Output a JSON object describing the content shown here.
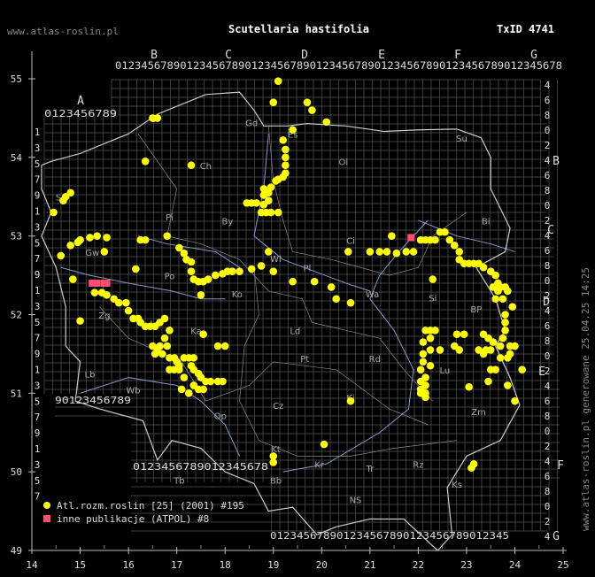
{
  "header": {
    "site": "www.atlas-roslin.pl",
    "title": "Scutellaria hastifolia",
    "taxon_id": "TxID 4741"
  },
  "side_note": "www.atlas-roslin.pl generowane 25.04.25 14:25",
  "axes": {
    "lon_ticks": [
      "14",
      "15",
      "16",
      "17",
      "18",
      "19",
      "20",
      "21",
      "22",
      "23",
      "24",
      "25"
    ],
    "lat_ticks": [
      "49",
      "50",
      "51",
      "52",
      "53",
      "54",
      "55"
    ]
  },
  "atpol": {
    "top_letters": [
      "B",
      "C",
      "D",
      "E",
      "F",
      "G"
    ],
    "top_digits": "012345678901234567890123456789012345678901234567890123456789012345678",
    "bottom_digits_a": "0123456789",
    "bottom_digits_b": "0123456789012345678901234567890123456789012345",
    "a_letter": "A",
    "a_digits": "0123456789",
    "west_digits": [
      "1",
      "3",
      "5",
      "7",
      "9",
      "1",
      "3",
      "5",
      "7",
      "9",
      "1",
      "3",
      "5",
      "7",
      "9",
      "1",
      "3",
      "5",
      "7",
      "9",
      "1",
      "3",
      "5",
      "7"
    ],
    "east_letters": [
      "B",
      "C",
      "D",
      "E",
      "F",
      "G"
    ],
    "east_digits": [
      "4",
      "6",
      "8",
      "0",
      "2",
      "4",
      "6",
      "8",
      "0",
      "2",
      "4",
      "6",
      "8",
      "0",
      "2",
      "4",
      "6",
      "8",
      "0",
      "2",
      "4",
      "6",
      "8",
      "0",
      "2",
      "4",
      "6",
      "8",
      "0",
      "2",
      "4"
    ],
    "bottom_left_digits": "90123456789",
    "bottom_left_digits2": "0123456789012345678"
  },
  "region_labels": [
    {
      "t": "Sl",
      "lon": 16.55,
      "lat": 54.45
    },
    {
      "t": "Gd",
      "lon": 18.55,
      "lat": 54.4
    },
    {
      "t": "Es",
      "lon": 19.4,
      "lat": 54.25
    },
    {
      "t": "Su",
      "lon": 22.9,
      "lat": 54.2
    },
    {
      "t": "Ol",
      "lon": 20.45,
      "lat": 53.9
    },
    {
      "t": "Ch",
      "lon": 17.6,
      "lat": 53.85
    },
    {
      "t": "Sz",
      "lon": 14.6,
      "lat": 53.45
    },
    {
      "t": "Pi",
      "lon": 16.85,
      "lat": 53.2
    },
    {
      "t": "By",
      "lon": 18.05,
      "lat": 53.15
    },
    {
      "t": "Bi",
      "lon": 23.4,
      "lat": 53.15
    },
    {
      "t": "Ci",
      "lon": 20.6,
      "lat": 52.9
    },
    {
      "t": "Gw",
      "lon": 15.25,
      "lat": 52.75
    },
    {
      "t": "Wl",
      "lon": 19.05,
      "lat": 52.67
    },
    {
      "t": "Pl",
      "lon": 19.7,
      "lat": 52.55
    },
    {
      "t": "Po",
      "lon": 16.85,
      "lat": 52.45
    },
    {
      "t": "Si",
      "lon": 22.3,
      "lat": 52.17
    },
    {
      "t": "BP",
      "lon": 23.2,
      "lat": 52.03
    },
    {
      "t": "Wa",
      "lon": 21.05,
      "lat": 52.22
    },
    {
      "t": "Ko",
      "lon": 18.25,
      "lat": 52.22
    },
    {
      "t": "Zg",
      "lon": 15.5,
      "lat": 51.95
    },
    {
      "t": "Le",
      "lon": 16.55,
      "lat": 51.85
    },
    {
      "t": "Ld",
      "lon": 19.45,
      "lat": 51.75
    },
    {
      "t": "Ka",
      "lon": 17.4,
      "lat": 51.75
    },
    {
      "t": "Pt",
      "lon": 19.65,
      "lat": 51.4
    },
    {
      "t": "Rd",
      "lon": 21.1,
      "lat": 51.4
    },
    {
      "t": "Lu",
      "lon": 22.55,
      "lat": 51.25
    },
    {
      "t": "Lb",
      "lon": 15.2,
      "lat": 51.2
    },
    {
      "t": "Wb",
      "lon": 16.1,
      "lat": 51.0
    },
    {
      "t": "Op",
      "lon": 17.9,
      "lat": 50.67
    },
    {
      "t": "Cz",
      "lon": 19.1,
      "lat": 50.8
    },
    {
      "t": "Ki",
      "lon": 20.6,
      "lat": 50.9
    },
    {
      "t": "Kt",
      "lon": 19.05,
      "lat": 50.25
    },
    {
      "t": "Tr",
      "lon": 21.0,
      "lat": 50.0
    },
    {
      "t": "Kr",
      "lon": 19.95,
      "lat": 50.05
    },
    {
      "t": "Rz",
      "lon": 22.0,
      "lat": 50.05
    },
    {
      "t": "NS",
      "lon": 20.7,
      "lat": 49.6
    },
    {
      "t": "Ks",
      "lon": 22.8,
      "lat": 49.8
    },
    {
      "t": "Zm",
      "lon": 23.25,
      "lat": 50.72
    },
    {
      "t": "Bb",
      "lon": 19.05,
      "lat": 49.85
    },
    {
      "t": "Tb",
      "lon": 17.05,
      "lat": 49.85
    }
  ],
  "legend": {
    "items": [
      {
        "label": "Atl.rozm.roslin [25] (2001) #195",
        "marker": "circle",
        "color": "#ffff00"
      },
      {
        "label": "inne publikacje (ATPOL) #8",
        "marker": "square",
        "color": "#ff4f6f"
      }
    ]
  },
  "colors": {
    "dot": "#ffff00",
    "pink": "#ff4f6f",
    "grid": "#555555",
    "border": "#cccccc",
    "river": "#8899cc",
    "frame": "#cccccc"
  },
  "records_yellow": [
    [
      19.1,
      54.97
    ],
    [
      19.0,
      54.7
    ],
    [
      19.7,
      54.7
    ],
    [
      19.8,
      54.6
    ],
    [
      20.1,
      54.45
    ],
    [
      16.5,
      54.5
    ],
    [
      16.6,
      54.5
    ],
    [
      19.4,
      54.35
    ],
    [
      19.2,
      54.22
    ],
    [
      19.25,
      54.1
    ],
    [
      19.25,
      54.0
    ],
    [
      19.25,
      53.9
    ],
    [
      19.25,
      53.8
    ],
    [
      19.2,
      53.75
    ],
    [
      19.1,
      53.72
    ],
    [
      19.05,
      53.7
    ],
    [
      18.95,
      53.62
    ],
    [
      18.9,
      53.55
    ],
    [
      18.9,
      53.45
    ],
    [
      18.8,
      53.4
    ],
    [
      18.75,
      53.3
    ],
    [
      18.85,
      53.3
    ],
    [
      18.95,
      53.3
    ],
    [
      19.1,
      53.3
    ],
    [
      18.45,
      53.42
    ],
    [
      18.55,
      53.42
    ],
    [
      18.65,
      53.42
    ],
    [
      18.8,
      53.52
    ],
    [
      18.8,
      53.6
    ],
    [
      16.35,
      53.95
    ],
    [
      17.3,
      53.9
    ],
    [
      14.65,
      53.45
    ],
    [
      14.7,
      53.5
    ],
    [
      14.8,
      53.55
    ],
    [
      14.45,
      53.3
    ],
    [
      14.6,
      52.75
    ],
    [
      14.8,
      52.88
    ],
    [
      14.95,
      52.92
    ],
    [
      15.0,
      52.95
    ],
    [
      15.2,
      52.98
    ],
    [
      15.35,
      53.0
    ],
    [
      15.55,
      52.98
    ],
    [
      16.25,
      52.95
    ],
    [
      16.35,
      52.95
    ],
    [
      16.8,
      53.0
    ],
    [
      15.5,
      52.8
    ],
    [
      16.15,
      52.58
    ],
    [
      17.05,
      52.85
    ],
    [
      17.15,
      52.78
    ],
    [
      17.2,
      52.7
    ],
    [
      17.3,
      52.67
    ],
    [
      17.3,
      52.55
    ],
    [
      17.35,
      52.45
    ],
    [
      17.45,
      52.42
    ],
    [
      17.55,
      52.42
    ],
    [
      17.65,
      52.45
    ],
    [
      17.8,
      52.5
    ],
    [
      17.95,
      52.52
    ],
    [
      18.05,
      52.55
    ],
    [
      18.15,
      52.55
    ],
    [
      18.3,
      52.55
    ],
    [
      18.55,
      52.58
    ],
    [
      18.75,
      52.62
    ],
    [
      18.9,
      52.8
    ],
    [
      19.0,
      52.55
    ],
    [
      19.4,
      52.42
    ],
    [
      19.85,
      52.42
    ],
    [
      20.2,
      52.35
    ],
    [
      20.3,
      52.2
    ],
    [
      20.55,
      52.8
    ],
    [
      21.0,
      52.8
    ],
    [
      21.2,
      52.8
    ],
    [
      21.35,
      52.8
    ],
    [
      21.45,
      53.0
    ],
    [
      21.55,
      52.78
    ],
    [
      21.75,
      52.8
    ],
    [
      21.9,
      52.8
    ],
    [
      22.05,
      52.95
    ],
    [
      22.15,
      52.95
    ],
    [
      22.25,
      52.95
    ],
    [
      22.35,
      52.95
    ],
    [
      22.45,
      53.05
    ],
    [
      22.55,
      53.05
    ],
    [
      22.65,
      52.95
    ],
    [
      22.75,
      52.88
    ],
    [
      22.85,
      52.8
    ],
    [
      22.85,
      52.7
    ],
    [
      22.95,
      52.65
    ],
    [
      23.05,
      52.65
    ],
    [
      23.15,
      52.65
    ],
    [
      23.25,
      52.65
    ],
    [
      23.35,
      52.6
    ],
    [
      23.5,
      52.55
    ],
    [
      23.6,
      52.5
    ],
    [
      23.65,
      52.4
    ],
    [
      23.7,
      52.35
    ],
    [
      23.8,
      52.35
    ],
    [
      23.55,
      52.35
    ],
    [
      23.65,
      52.3
    ],
    [
      23.6,
      52.2
    ],
    [
      23.75,
      52.2
    ],
    [
      23.85,
      52.3
    ],
    [
      23.95,
      52.1
    ],
    [
      23.8,
      52.0
    ],
    [
      23.8,
      51.9
    ],
    [
      23.8,
      51.8
    ],
    [
      23.75,
      51.7
    ],
    [
      23.7,
      51.6
    ],
    [
      23.55,
      51.65
    ],
    [
      23.45,
      51.7
    ],
    [
      23.35,
      51.75
    ],
    [
      23.5,
      51.55
    ],
    [
      23.35,
      51.5
    ],
    [
      23.9,
      51.6
    ],
    [
      24.0,
      51.6
    ],
    [
      23.9,
      51.5
    ],
    [
      23.7,
      51.45
    ],
    [
      23.6,
      51.3
    ],
    [
      23.5,
      51.3
    ],
    [
      23.85,
      51.45
    ],
    [
      24.15,
      51.3
    ],
    [
      23.45,
      51.15
    ],
    [
      23.05,
      51.08
    ],
    [
      22.45,
      51.55
    ],
    [
      22.75,
      51.6
    ],
    [
      22.8,
      51.75
    ],
    [
      22.95,
      51.75
    ],
    [
      22.85,
      51.55
    ],
    [
      23.4,
      51.55
    ],
    [
      23.25,
      51.55
    ],
    [
      22.35,
      51.8
    ],
    [
      22.25,
      51.7
    ],
    [
      22.25,
      51.8
    ],
    [
      22.15,
      51.8
    ],
    [
      22.1,
      51.65
    ],
    [
      22.25,
      51.55
    ],
    [
      22.1,
      51.5
    ],
    [
      22.1,
      51.4
    ],
    [
      22.25,
      51.35
    ],
    [
      22.05,
      51.3
    ],
    [
      22.15,
      51.2
    ],
    [
      22.05,
      51.15
    ],
    [
      22.15,
      51.1
    ],
    [
      22.05,
      51.05
    ],
    [
      22.15,
      51.0
    ],
    [
      22.05,
      51.0
    ],
    [
      22.15,
      50.95
    ],
    [
      24.0,
      50.9
    ],
    [
      23.85,
      51.1
    ],
    [
      20.6,
      50.9
    ],
    [
      23.15,
      50.1
    ],
    [
      23.1,
      50.05
    ],
    [
      20.05,
      50.35
    ],
    [
      19.0,
      50.2
    ],
    [
      19.0,
      50.12
    ],
    [
      22.3,
      52.45
    ],
    [
      20.6,
      52.15
    ],
    [
      14.85,
      52.45
    ],
    [
      15.3,
      52.28
    ],
    [
      15.45,
      52.28
    ],
    [
      15.55,
      52.25
    ],
    [
      15.7,
      52.2
    ],
    [
      15.8,
      52.15
    ],
    [
      15.95,
      52.15
    ],
    [
      16.0,
      52.05
    ],
    [
      16.1,
      51.95
    ],
    [
      16.2,
      51.95
    ],
    [
      16.25,
      51.9
    ],
    [
      16.35,
      51.85
    ],
    [
      16.45,
      51.85
    ],
    [
      16.55,
      51.85
    ],
    [
      16.65,
      51.9
    ],
    [
      16.75,
      51.95
    ],
    [
      16.85,
      51.8
    ],
    [
      16.5,
      51.6
    ],
    [
      16.6,
      51.55
    ],
    [
      16.65,
      51.6
    ],
    [
      16.75,
      51.7
    ],
    [
      16.8,
      51.6
    ],
    [
      16.55,
      51.5
    ],
    [
      16.7,
      51.5
    ],
    [
      16.85,
      51.45
    ],
    [
      16.95,
      51.45
    ],
    [
      17.0,
      51.4
    ],
    [
      17.05,
      51.35
    ],
    [
      17.15,
      51.45
    ],
    [
      17.25,
      51.45
    ],
    [
      17.35,
      51.45
    ],
    [
      17.3,
      51.35
    ],
    [
      17.35,
      51.3
    ],
    [
      17.45,
      51.25
    ],
    [
      17.5,
      51.2
    ],
    [
      17.6,
      51.15
    ],
    [
      17.7,
      51.15
    ],
    [
      17.85,
      51.15
    ],
    [
      17.95,
      51.15
    ],
    [
      17.35,
      51.1
    ],
    [
      17.45,
      51.05
    ],
    [
      17.55,
      51.05
    ],
    [
      17.25,
      51.0
    ],
    [
      17.1,
      51.05
    ],
    [
      17.15,
      51.2
    ],
    [
      17.05,
      51.3
    ],
    [
      16.95,
      51.3
    ],
    [
      16.85,
      51.3
    ],
    [
      17.85,
      51.6
    ],
    [
      18.0,
      51.6
    ],
    [
      17.55,
      51.75
    ],
    [
      17.5,
      52.25
    ],
    [
      15.0,
      51.92
    ]
  ],
  "records_pink": [
    [
      15.25,
      52.4
    ],
    [
      15.35,
      52.4
    ],
    [
      15.5,
      52.4
    ],
    [
      15.55,
      52.4
    ],
    [
      21.85,
      52.98
    ]
  ]
}
